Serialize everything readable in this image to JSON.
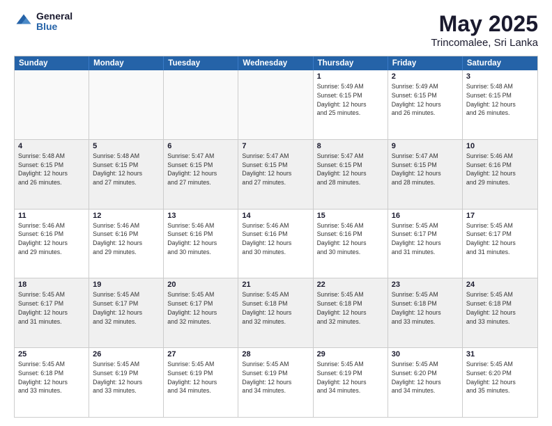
{
  "logo": {
    "general": "General",
    "blue": "Blue"
  },
  "title": "May 2025",
  "subtitle": "Trincomalee, Sri Lanka",
  "days": [
    "Sunday",
    "Monday",
    "Tuesday",
    "Wednesday",
    "Thursday",
    "Friday",
    "Saturday"
  ],
  "weeks": [
    [
      {
        "day": "",
        "info": ""
      },
      {
        "day": "",
        "info": ""
      },
      {
        "day": "",
        "info": ""
      },
      {
        "day": "",
        "info": ""
      },
      {
        "day": "1",
        "info": "Sunrise: 5:49 AM\nSunset: 6:15 PM\nDaylight: 12 hours\nand 25 minutes."
      },
      {
        "day": "2",
        "info": "Sunrise: 5:49 AM\nSunset: 6:15 PM\nDaylight: 12 hours\nand 26 minutes."
      },
      {
        "day": "3",
        "info": "Sunrise: 5:48 AM\nSunset: 6:15 PM\nDaylight: 12 hours\nand 26 minutes."
      }
    ],
    [
      {
        "day": "4",
        "info": "Sunrise: 5:48 AM\nSunset: 6:15 PM\nDaylight: 12 hours\nand 26 minutes."
      },
      {
        "day": "5",
        "info": "Sunrise: 5:48 AM\nSunset: 6:15 PM\nDaylight: 12 hours\nand 27 minutes."
      },
      {
        "day": "6",
        "info": "Sunrise: 5:47 AM\nSunset: 6:15 PM\nDaylight: 12 hours\nand 27 minutes."
      },
      {
        "day": "7",
        "info": "Sunrise: 5:47 AM\nSunset: 6:15 PM\nDaylight: 12 hours\nand 27 minutes."
      },
      {
        "day": "8",
        "info": "Sunrise: 5:47 AM\nSunset: 6:15 PM\nDaylight: 12 hours\nand 28 minutes."
      },
      {
        "day": "9",
        "info": "Sunrise: 5:47 AM\nSunset: 6:15 PM\nDaylight: 12 hours\nand 28 minutes."
      },
      {
        "day": "10",
        "info": "Sunrise: 5:46 AM\nSunset: 6:16 PM\nDaylight: 12 hours\nand 29 minutes."
      }
    ],
    [
      {
        "day": "11",
        "info": "Sunrise: 5:46 AM\nSunset: 6:16 PM\nDaylight: 12 hours\nand 29 minutes."
      },
      {
        "day": "12",
        "info": "Sunrise: 5:46 AM\nSunset: 6:16 PM\nDaylight: 12 hours\nand 29 minutes."
      },
      {
        "day": "13",
        "info": "Sunrise: 5:46 AM\nSunset: 6:16 PM\nDaylight: 12 hours\nand 30 minutes."
      },
      {
        "day": "14",
        "info": "Sunrise: 5:46 AM\nSunset: 6:16 PM\nDaylight: 12 hours\nand 30 minutes."
      },
      {
        "day": "15",
        "info": "Sunrise: 5:46 AM\nSunset: 6:16 PM\nDaylight: 12 hours\nand 30 minutes."
      },
      {
        "day": "16",
        "info": "Sunrise: 5:45 AM\nSunset: 6:17 PM\nDaylight: 12 hours\nand 31 minutes."
      },
      {
        "day": "17",
        "info": "Sunrise: 5:45 AM\nSunset: 6:17 PM\nDaylight: 12 hours\nand 31 minutes."
      }
    ],
    [
      {
        "day": "18",
        "info": "Sunrise: 5:45 AM\nSunset: 6:17 PM\nDaylight: 12 hours\nand 31 minutes."
      },
      {
        "day": "19",
        "info": "Sunrise: 5:45 AM\nSunset: 6:17 PM\nDaylight: 12 hours\nand 32 minutes."
      },
      {
        "day": "20",
        "info": "Sunrise: 5:45 AM\nSunset: 6:17 PM\nDaylight: 12 hours\nand 32 minutes."
      },
      {
        "day": "21",
        "info": "Sunrise: 5:45 AM\nSunset: 6:18 PM\nDaylight: 12 hours\nand 32 minutes."
      },
      {
        "day": "22",
        "info": "Sunrise: 5:45 AM\nSunset: 6:18 PM\nDaylight: 12 hours\nand 32 minutes."
      },
      {
        "day": "23",
        "info": "Sunrise: 5:45 AM\nSunset: 6:18 PM\nDaylight: 12 hours\nand 33 minutes."
      },
      {
        "day": "24",
        "info": "Sunrise: 5:45 AM\nSunset: 6:18 PM\nDaylight: 12 hours\nand 33 minutes."
      }
    ],
    [
      {
        "day": "25",
        "info": "Sunrise: 5:45 AM\nSunset: 6:18 PM\nDaylight: 12 hours\nand 33 minutes."
      },
      {
        "day": "26",
        "info": "Sunrise: 5:45 AM\nSunset: 6:19 PM\nDaylight: 12 hours\nand 33 minutes."
      },
      {
        "day": "27",
        "info": "Sunrise: 5:45 AM\nSunset: 6:19 PM\nDaylight: 12 hours\nand 34 minutes."
      },
      {
        "day": "28",
        "info": "Sunrise: 5:45 AM\nSunset: 6:19 PM\nDaylight: 12 hours\nand 34 minutes."
      },
      {
        "day": "29",
        "info": "Sunrise: 5:45 AM\nSunset: 6:19 PM\nDaylight: 12 hours\nand 34 minutes."
      },
      {
        "day": "30",
        "info": "Sunrise: 5:45 AM\nSunset: 6:20 PM\nDaylight: 12 hours\nand 34 minutes."
      },
      {
        "day": "31",
        "info": "Sunrise: 5:45 AM\nSunset: 6:20 PM\nDaylight: 12 hours\nand 35 minutes."
      }
    ]
  ]
}
